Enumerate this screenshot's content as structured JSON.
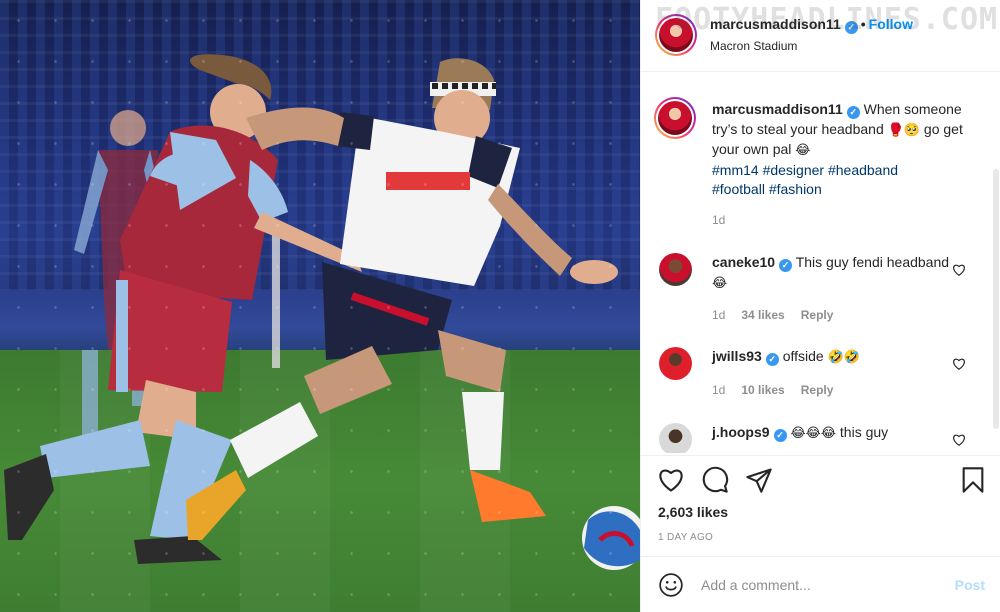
{
  "post": {
    "image_alt": "",
    "header": {
      "username": "marcusmaddison11",
      "verified": true,
      "follow_label": "Follow",
      "location": "Macron Stadium"
    },
    "caption": {
      "username": "marcusmaddison11",
      "text_1": "When someone try’s to steal your headband",
      "emoji_1": "🥊🥺",
      "text_2": "go get your own pal",
      "emoji_2": "😂",
      "tags": [
        "#mm14",
        "#designer",
        "#headband",
        "#football",
        "#fashion"
      ],
      "time": "1d"
    },
    "comments": [
      {
        "username": "caneke10",
        "verified": true,
        "text": "This guy fendi headband",
        "emoji": "😂",
        "time": "1d",
        "likes": "34 likes",
        "reply": "Reply"
      },
      {
        "username": "jwills93",
        "verified": true,
        "text": "offside",
        "emoji": "🤣🤣",
        "time": "1d",
        "likes": "10 likes",
        "reply": "Reply"
      },
      {
        "username": "j.hoops9",
        "verified": true,
        "text": "this guy",
        "emoji": "😂😂😂",
        "time": "",
        "likes": "",
        "reply": ""
      }
    ],
    "likes_count": "2,603 likes",
    "post_time": "1 DAY AGO",
    "add_comment_placeholder": "Add a comment...",
    "post_button": "Post",
    "watermark": "FOOTYHEADLINES.COM"
  },
  "icons": [
    "heart-icon",
    "comment-icon",
    "share-icon",
    "save-icon",
    "smile-icon",
    "verified-icon"
  ],
  "colors": {
    "link": "#0095f6",
    "hashtag": "#00376b",
    "muted": "#8e8e8e",
    "post_disabled": "#b2dffc"
  }
}
